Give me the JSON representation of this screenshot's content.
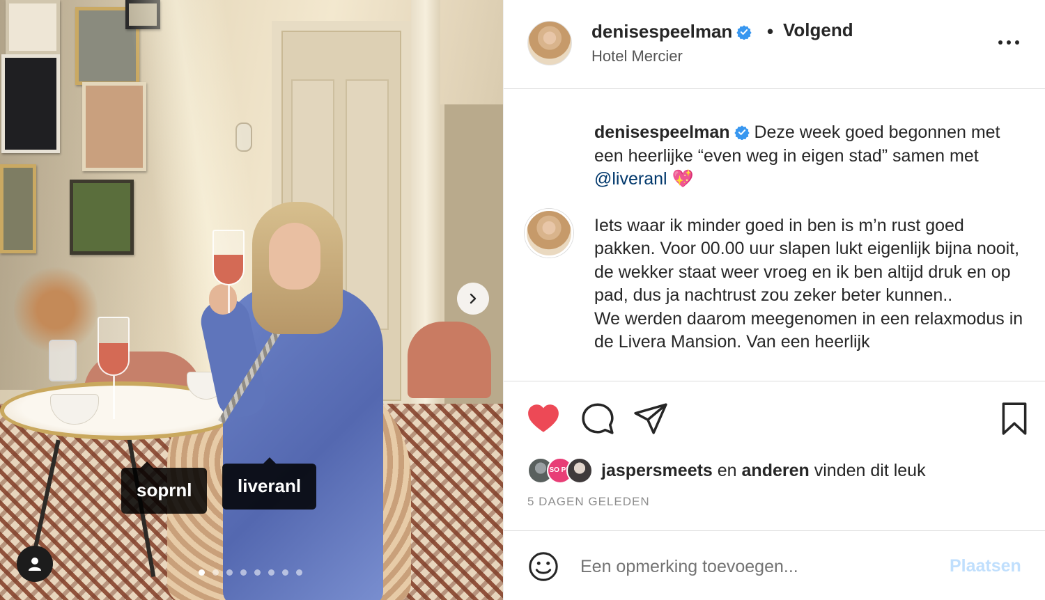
{
  "post": {
    "username": "denisespeelman",
    "follow_status": "Volgend",
    "separator": "•",
    "location": "Hotel Mercier",
    "more_options": "more-options"
  },
  "photo": {
    "tags": [
      "soprnl",
      "liveranl"
    ],
    "carousel": {
      "total": 8,
      "active_index": 0
    }
  },
  "caption": {
    "username": "denisespeelman",
    "line1": " Deze week goed begonnen met een heerlijke “even weg in eigen stad” samen met ",
    "mention": "@liveranl",
    "emoji": "💖",
    "para2": "Iets waar ik minder goed in ben is m’n rust goed pakken. Voor 00.00 uur slapen lukt eigenlijk bijna nooit, de wekker staat weer vroeg en ik ben altijd druk en op pad, dus ja nachtrust zou zeker beter kunnen..",
    "para3": "We werden daarom meegenomen in een relaxmodus in de Livera Mansion. Van een heerlijk"
  },
  "likes": {
    "avatar_badge": "SO PR",
    "first_user": "jaspersmeets",
    "connector": " en ",
    "others": "anderen",
    "suffix": " vinden dit leuk"
  },
  "timestamp": "5 DAGEN GELEDEN",
  "comment": {
    "placeholder": "Een opmerking toevoegen...",
    "submit_label": "Plaatsen"
  },
  "colors": {
    "like_red": "#ed4956",
    "verified_blue": "#3897f0",
    "mention_blue": "#00376b",
    "submit_disabled": "#c0dffd"
  }
}
